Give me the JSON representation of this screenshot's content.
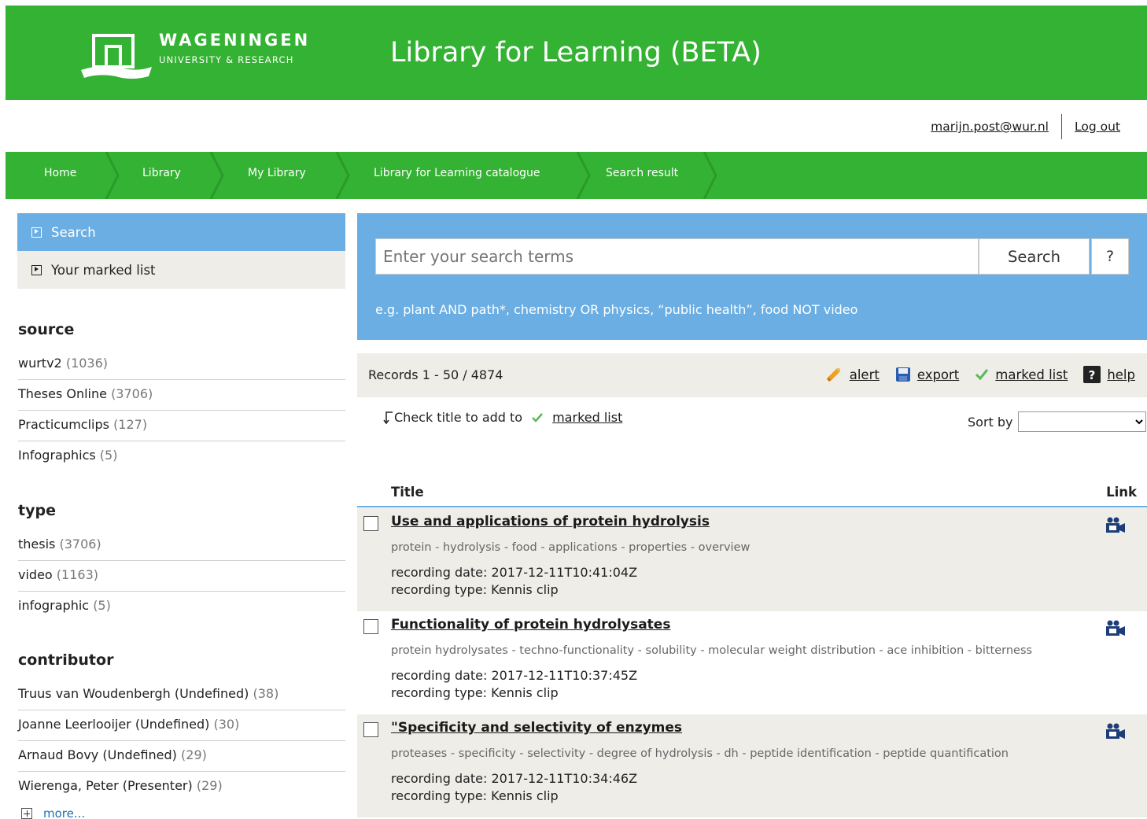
{
  "header": {
    "logo_line1": "WAGENINGEN",
    "logo_line2": "UNIVERSITY & RESEARCH",
    "title": "Library for Learning (BETA)",
    "brand_color": "#34b233"
  },
  "user": {
    "email": "marijn.post@wur.nl",
    "logout": "Log out"
  },
  "breadcrumb": [
    "Home",
    "Library",
    "My Library",
    "Library for Learning catalogue",
    "Search result"
  ],
  "sidebar": {
    "menu": [
      {
        "label": "Search",
        "active": true
      },
      {
        "label": "Your marked list",
        "active": false
      }
    ],
    "facets": [
      {
        "title": "source",
        "items": [
          {
            "label": "wurtv2",
            "count": "(1036)"
          },
          {
            "label": "Theses Online",
            "count": "(3706)"
          },
          {
            "label": "Practicumclips",
            "count": "(127)"
          },
          {
            "label": "Infographics",
            "count": "(5)"
          }
        ]
      },
      {
        "title": "type",
        "items": [
          {
            "label": "thesis",
            "count": "(3706)"
          },
          {
            "label": "video",
            "count": "(1163)"
          },
          {
            "label": "infographic",
            "count": "(5)"
          }
        ]
      },
      {
        "title": "contributor",
        "items": [
          {
            "label": "Truus van Woudenbergh (Undefined)",
            "count": "(38)"
          },
          {
            "label": "Joanne Leerlooijer (Undefined)",
            "count": "(30)"
          },
          {
            "label": "Arnaud Bovy (Undefined)",
            "count": "(29)"
          },
          {
            "label": "Wierenga, Peter (Presenter)",
            "count": "(29)"
          }
        ]
      }
    ],
    "more": "more..."
  },
  "search": {
    "placeholder": "Enter your search terms",
    "button": "Search",
    "help": "?",
    "hint": "e.g. plant AND path*, chemistry OR physics, “public health”, food NOT video",
    "panel_color": "#6aaee3"
  },
  "results_bar": {
    "records": "Records 1 - 50 / 4874",
    "alert": "alert",
    "export": "export",
    "marked_list": "marked list",
    "help": "help"
  },
  "check_hint": {
    "text": "Check title to add to",
    "link": "marked list"
  },
  "sort": {
    "label": "Sort by",
    "selected": ""
  },
  "table": {
    "col_title": "Title",
    "col_link": "Link",
    "rows": [
      {
        "title": "Use and applications of protein hydrolysis",
        "keywords": "protein - hydrolysis - food - applications - properties - overview",
        "date": "recording date: 2017-12-11T10:41:04Z",
        "type": "recording type: Kennis clip",
        "icon": "video-camera-icon"
      },
      {
        "title": "Functionality of protein hydrolysates",
        "keywords": "protein hydrolysates - techno-functionality - solubility - molecular weight distribution - ace inhibition - bitterness",
        "date": "recording date: 2017-12-11T10:37:45Z",
        "type": "recording type: Kennis clip",
        "icon": "video-camera-icon"
      },
      {
        "title": "\"Specificity and selectivity of enzymes",
        "keywords": "proteases - specificity - selectivity - degree of hydrolysis - dh - peptide identification - peptide quantification",
        "date": "recording date: 2017-12-11T10:34:46Z",
        "type": "recording type: Kennis clip",
        "icon": "video-camera-icon"
      }
    ]
  }
}
